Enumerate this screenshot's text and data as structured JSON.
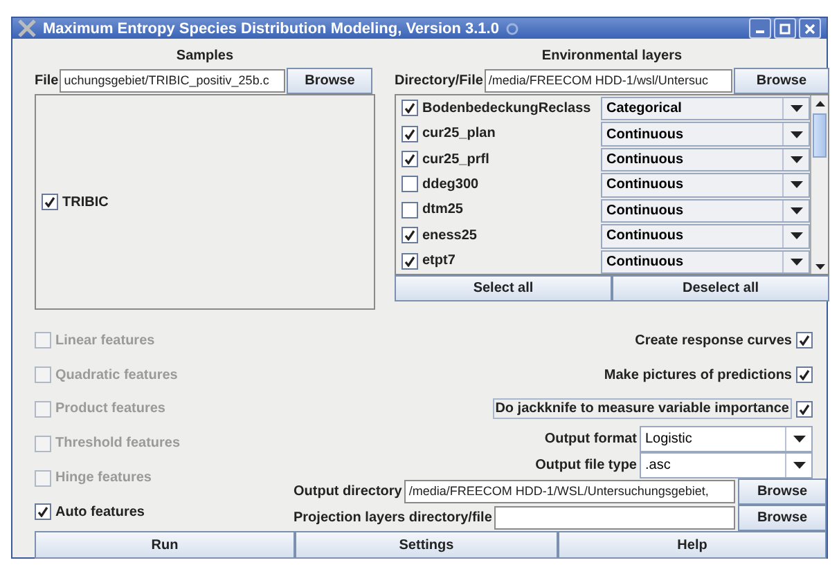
{
  "window": {
    "title": "Maximum Entropy Species Distribution Modeling, Version 3.1.0"
  },
  "samples": {
    "heading": "Samples",
    "file_label": "File",
    "file_value": "uchungsgebiet/TRIBIC_positiv_25b.c",
    "browse": "Browse",
    "species": [
      {
        "name": "TRIBIC",
        "checked": true
      }
    ]
  },
  "environmental_layers": {
    "heading": "Environmental layers",
    "dir_label": "Directory/File",
    "dir_value": "/media/FREECOM HDD-1/wsl/Untersuc",
    "browse": "Browse",
    "layers": [
      {
        "name": "BodenbedeckungReclass",
        "checked": true,
        "type": "Categorical"
      },
      {
        "name": "cur25_plan",
        "checked": true,
        "type": "Continuous"
      },
      {
        "name": "cur25_prfl",
        "checked": true,
        "type": "Continuous"
      },
      {
        "name": "ddeg300",
        "checked": false,
        "type": "Continuous"
      },
      {
        "name": "dtm25",
        "checked": false,
        "type": "Continuous"
      },
      {
        "name": "eness25",
        "checked": true,
        "type": "Continuous"
      },
      {
        "name": "etpt7",
        "checked": true,
        "type": "Continuous"
      }
    ],
    "select_all": "Select all",
    "deselect_all": "Deselect all"
  },
  "features": [
    {
      "label": "Linear features",
      "checked": false,
      "disabled": true
    },
    {
      "label": "Quadratic features",
      "checked": false,
      "disabled": true
    },
    {
      "label": "Product features",
      "checked": false,
      "disabled": true
    },
    {
      "label": "Threshold features",
      "checked": false,
      "disabled": true
    },
    {
      "label": "Hinge features",
      "checked": false,
      "disabled": true
    },
    {
      "label": "Auto features",
      "checked": true,
      "disabled": false
    }
  ],
  "options": [
    {
      "label": "Create response curves",
      "checked": true,
      "focused": false
    },
    {
      "label": "Make pictures of predictions",
      "checked": true,
      "focused": false
    },
    {
      "label": "Do jackknife to measure variable importance",
      "checked": true,
      "focused": true
    }
  ],
  "output_format": {
    "label": "Output format",
    "value": "Logistic"
  },
  "output_file_type": {
    "label": "Output file type",
    "value": ".asc"
  },
  "output_directory": {
    "label": "Output directory",
    "value": "/media/FREECOM HDD-1/WSL/Untersuchungsgebiet,",
    "browse": "Browse"
  },
  "projection_layers": {
    "label": "Projection layers directory/file",
    "browse": "Browse"
  },
  "buttons": [
    "Run",
    "Settings",
    "Help"
  ]
}
